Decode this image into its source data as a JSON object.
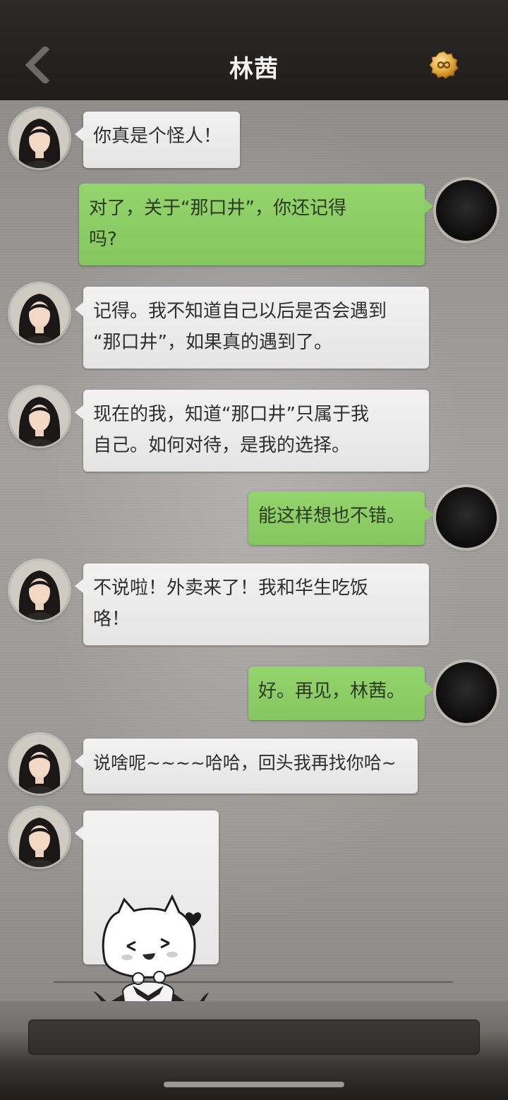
{
  "header": {
    "title": "林茜"
  },
  "messages": [
    {
      "side": "left",
      "text": "你真是个怪人！"
    },
    {
      "side": "right",
      "text": "对了，关于“那口井”，你还记得\n吗?"
    },
    {
      "side": "left",
      "text": "记得。我不知道自己以后是否会遇到\n“那口井”，如果真的遇到了。"
    },
    {
      "side": "left",
      "text": "现在的我，知道“那口井”只属于我\n自己。如何对待，是我的选择。"
    },
    {
      "side": "right",
      "text": "能这样想也不错。"
    },
    {
      "side": "left",
      "text": "不说啦！外卖来了！我和华生吃饭\n咯！"
    },
    {
      "side": "right",
      "text": "好。再见，林茜。"
    },
    {
      "side": "left",
      "text": "说啥呢~~~~哈哈，回头我再找你哈~"
    },
    {
      "side": "left",
      "type": "sticker",
      "icon": "vampire-cat-sticker"
    }
  ],
  "icons": {
    "back": "chevron-left-icon",
    "badge": "infinity-badge-icon"
  },
  "colors": {
    "header_bg": "#242321",
    "right_bubble": "#8ccd65",
    "left_bubble": "#eeeeee",
    "badge_gold": "#e0a93a"
  }
}
